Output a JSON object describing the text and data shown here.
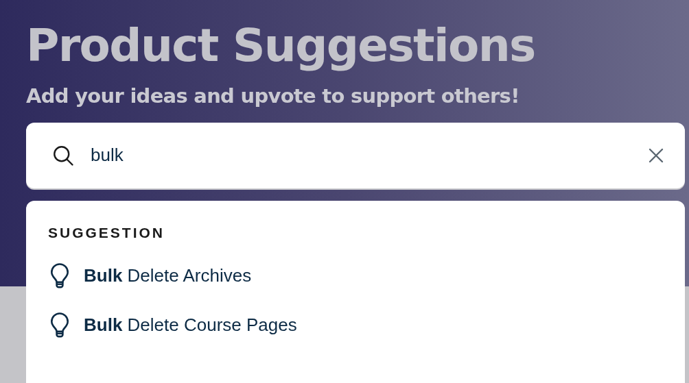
{
  "header": {
    "title": "Product Suggestions",
    "subtitle": "Add your ideas and upvote to support others!"
  },
  "search": {
    "value": "bulk"
  },
  "results": {
    "heading": "SUGGESTION",
    "items": [
      {
        "text": "**Bulk** Delete Archives"
      },
      {
        "text": "**Bulk** Delete Course Pages"
      }
    ]
  }
}
